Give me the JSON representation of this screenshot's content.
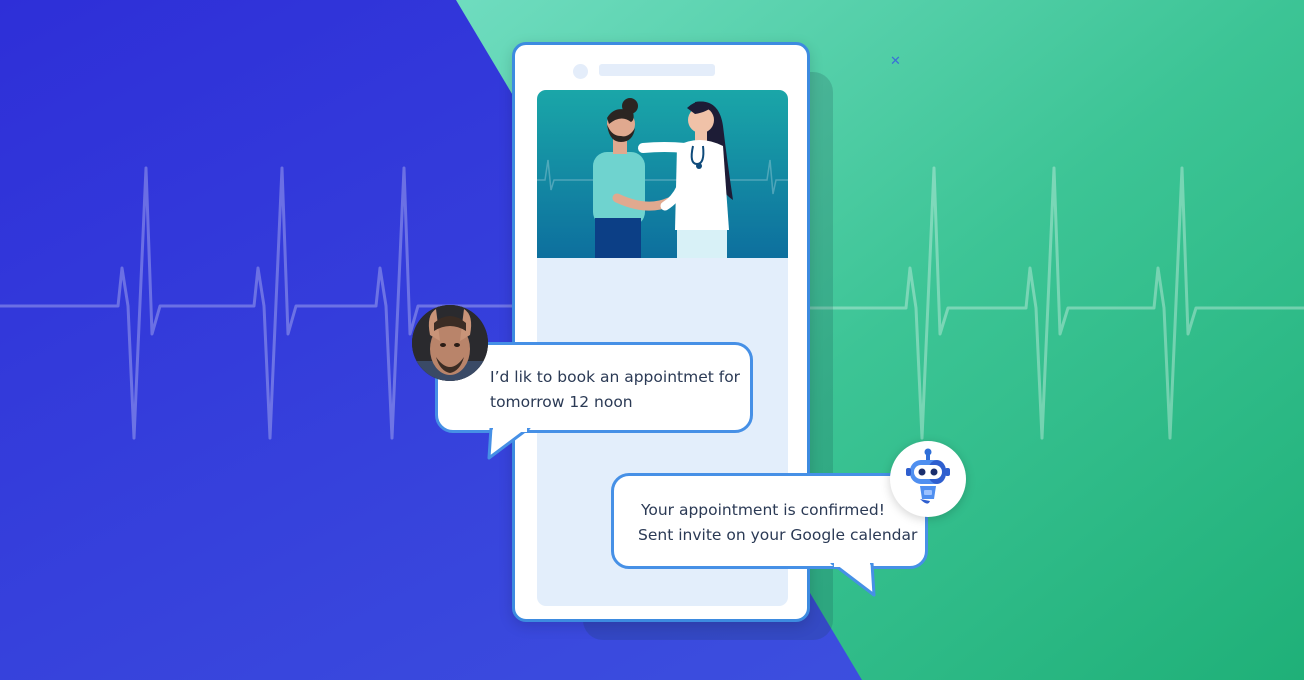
{
  "chat": {
    "user_message": {
      "lines": [
        "I’d lik to book an appointmet for",
        "tomorrow 12 noon"
      ]
    },
    "bot_message": {
      "lines": [
        "Your appointment is confirmed!",
        "Sent invite on your Google calendar"
      ]
    }
  },
  "icons": {
    "user_avatar": "person-photo-avatar",
    "bot_avatar": "robot-icon",
    "hero": "doctor-patient-illustration",
    "decoration": "sparkle-icon"
  },
  "colors": {
    "left_background": "#3237d9",
    "right_background": "#27b787",
    "accent_border": "#4690e6",
    "screen": "#e3eefb"
  }
}
